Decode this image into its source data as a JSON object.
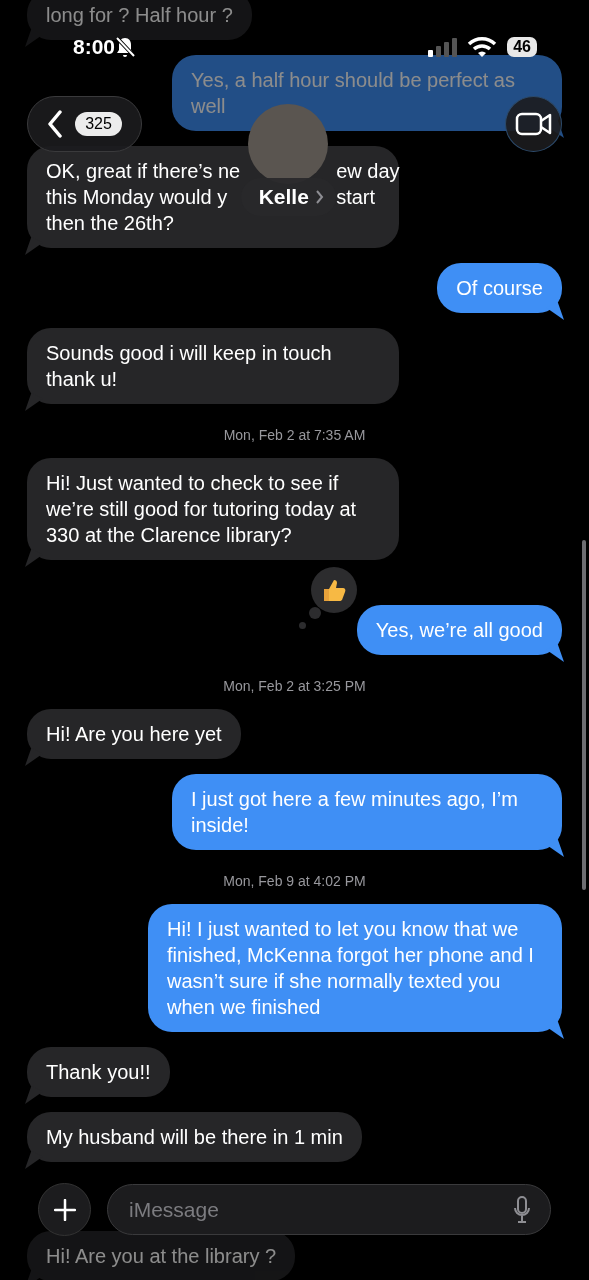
{
  "status_bar": {
    "time": "8:00",
    "silent": true,
    "battery": "46"
  },
  "header": {
    "back_count": "325",
    "contact_name": "Kelle"
  },
  "messages": [
    {
      "kind": "received",
      "text": "long for ? Half hour ?",
      "tapback": false
    },
    {
      "kind": "sent",
      "text": "Yes, a half hour should be perfect as well",
      "tapback": false
    },
    {
      "kind": "received",
      "lines": [
        [
          "OK, great if there’s ne",
          "ew day"
        ],
        [
          "this Monday would y",
          "start"
        ],
        [
          "then the 26th?"
        ]
      ],
      "tapback": false
    },
    {
      "kind": "sent",
      "text": "Of course",
      "tapback": false
    },
    {
      "kind": "received",
      "text": "Sounds good i will keep in touch thank u!",
      "tapback": false
    },
    {
      "kind": "timestamp",
      "text": "Mon, Feb 2 at 7:35 AM"
    },
    {
      "kind": "received",
      "text": "Hi! Just wanted to check to see if we’re still good for tutoring today at 330 at the Clarence library?",
      "tapback": false
    },
    {
      "kind": "sent",
      "text": "Yes, we’re all good",
      "tapback": true
    },
    {
      "kind": "timestamp",
      "text": "Mon, Feb 2 at 3:25 PM"
    },
    {
      "kind": "received",
      "text": "Hi! Are you here yet",
      "tapback": false
    },
    {
      "kind": "sent",
      "text": "I just got here a few minutes ago, I’m inside!",
      "tapback": false
    },
    {
      "kind": "timestamp",
      "text": "Mon, Feb 9 at 4:02 PM"
    },
    {
      "kind": "sent",
      "text": "Hi! I just wanted to let you know that we finished, McKenna forgot her phone and I wasn’t sure if she normally texted you when we finished",
      "tapback": false
    },
    {
      "kind": "received",
      "text": "Thank you!!",
      "tapback": false
    },
    {
      "kind": "received",
      "text": "My husband will be there in 1 min",
      "tapback": false
    },
    {
      "kind": "received",
      "text": "Hi! Are you at the library ?",
      "tapback": false
    }
  ],
  "composer": {
    "placeholder": "iMessage"
  }
}
